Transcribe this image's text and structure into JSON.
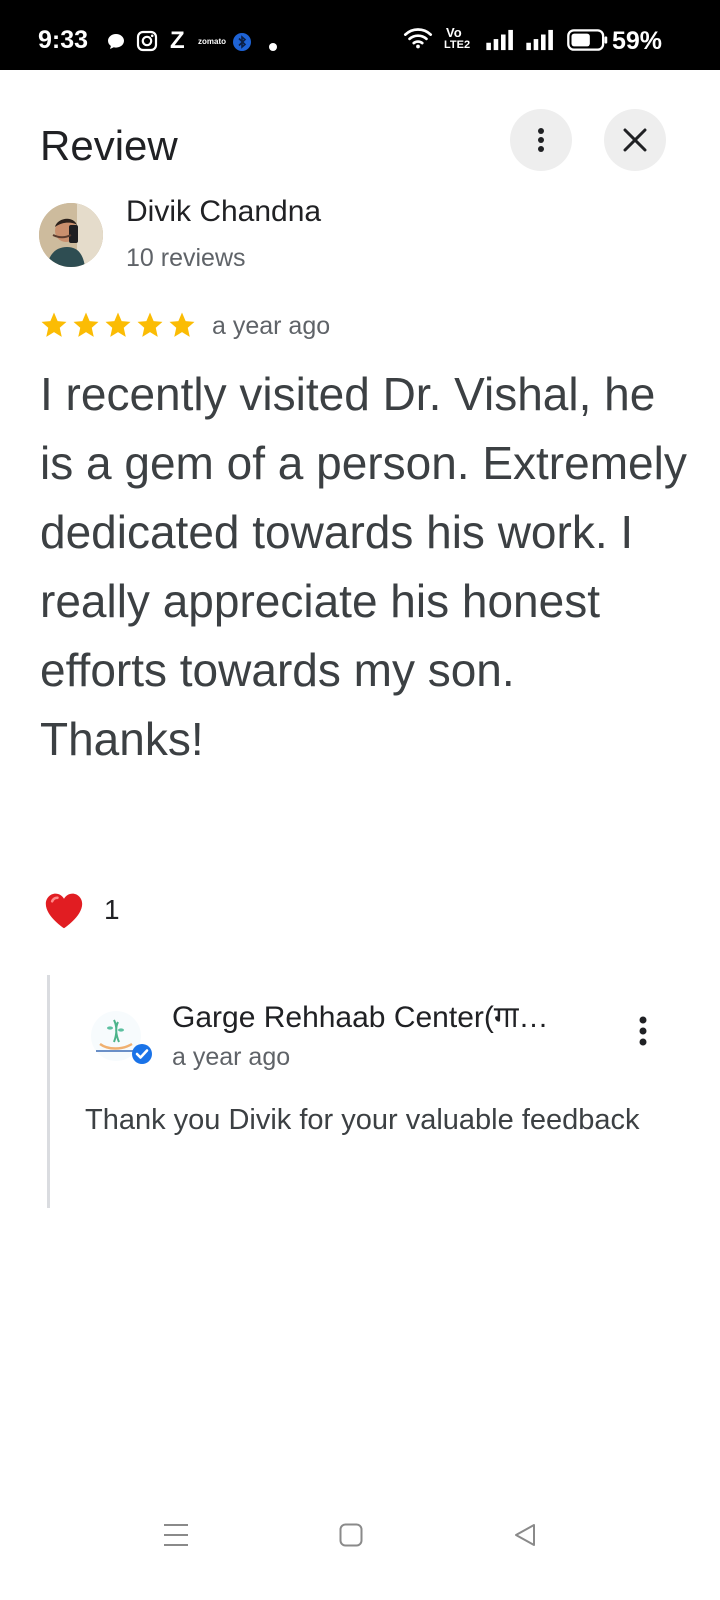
{
  "status_bar": {
    "time": "9:33",
    "notification_z": "Z",
    "notification_zomato": "zomato",
    "network_label_top": "Vo",
    "network_label_bottom": "LTE2",
    "battery": "59%",
    "icons": [
      "chat-bubble-icon",
      "instagram-icon",
      "z-icon",
      "zomato-icon",
      "bluetooth-app-icon",
      "dot-icon",
      "wifi-icon",
      "volte-icon",
      "signal-icon",
      "signal-icon",
      "battery-icon"
    ]
  },
  "header": {
    "title": "Review",
    "more_icon": "more-vert-icon",
    "close_icon": "close-icon"
  },
  "reviewer": {
    "name": "Divik Chandna",
    "review_count": "10 reviews"
  },
  "review": {
    "rating": 5,
    "date": "a year ago",
    "text": "I recently visited Dr. Vishal, he is a gem of a person. Extremely dedicated towards his work. I really appreciate his honest efforts towards my son. Thanks!",
    "star_color": "#fbbc04"
  },
  "reaction": {
    "icon": "heart-icon",
    "count": "1"
  },
  "owner_reply": {
    "name": "Garge Rehhaab Center(गा…",
    "date": "a year ago",
    "text": "Thank you Divik for your valuable feedback",
    "verified_color": "#1a73e8"
  },
  "nav_bar": {
    "buttons": [
      "menu-icon",
      "home-icon",
      "back-icon"
    ]
  }
}
